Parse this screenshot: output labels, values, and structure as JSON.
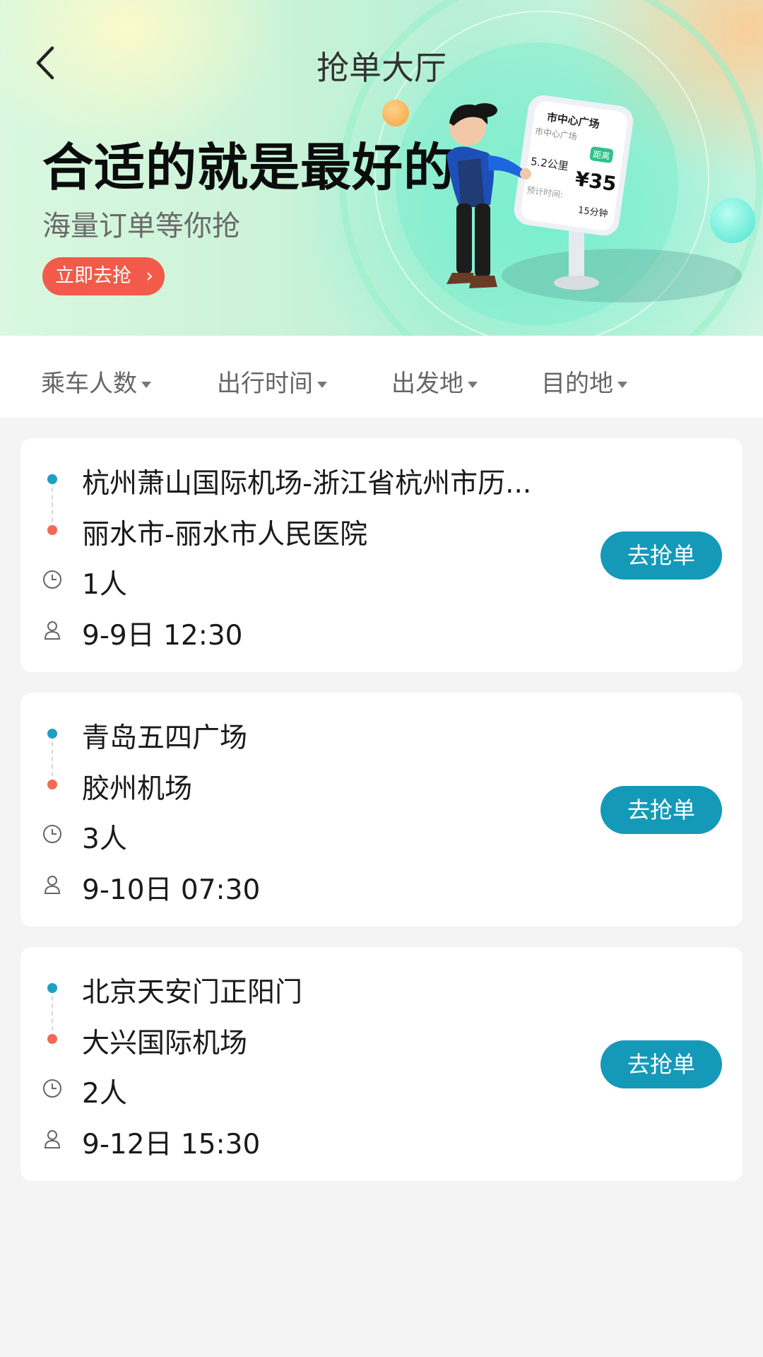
{
  "header": {
    "title": "抢单大厅"
  },
  "banner": {
    "headline": "合适的就是最好的",
    "subline": "海量订单等你抢",
    "cta_label": "立即去抢",
    "sign": {
      "title": "市中心广场",
      "subtitle": "市中心广场",
      "tag": "距离",
      "distance": "5.2公里",
      "price": "¥35",
      "eta_label": "预计时间:",
      "eta": "15分钟"
    }
  },
  "filters": [
    {
      "label": "乘车人数"
    },
    {
      "label": "出行时间"
    },
    {
      "label": "出发地"
    },
    {
      "label": "目的地"
    }
  ],
  "orders": [
    {
      "from": "杭州萧山国际机场-浙江省杭州市历...",
      "to": "丽水市-丽水市人民医院",
      "people": "1人",
      "time": "9-9日 12:30",
      "action": "去抢单"
    },
    {
      "from": "青岛五四广场",
      "to": "胶州机场",
      "people": "3人",
      "time": "9-10日 07:30",
      "action": "去抢单"
    },
    {
      "from": "北京天安门正阳门",
      "to": "大兴国际机场",
      "people": "2人",
      "time": "9-12日 15:30",
      "action": "去抢单"
    }
  ],
  "colors": {
    "accent": "#1599b9",
    "cta": "#f25a4a",
    "start_dot": "#1f9fc4",
    "end_dot": "#f06a55"
  }
}
